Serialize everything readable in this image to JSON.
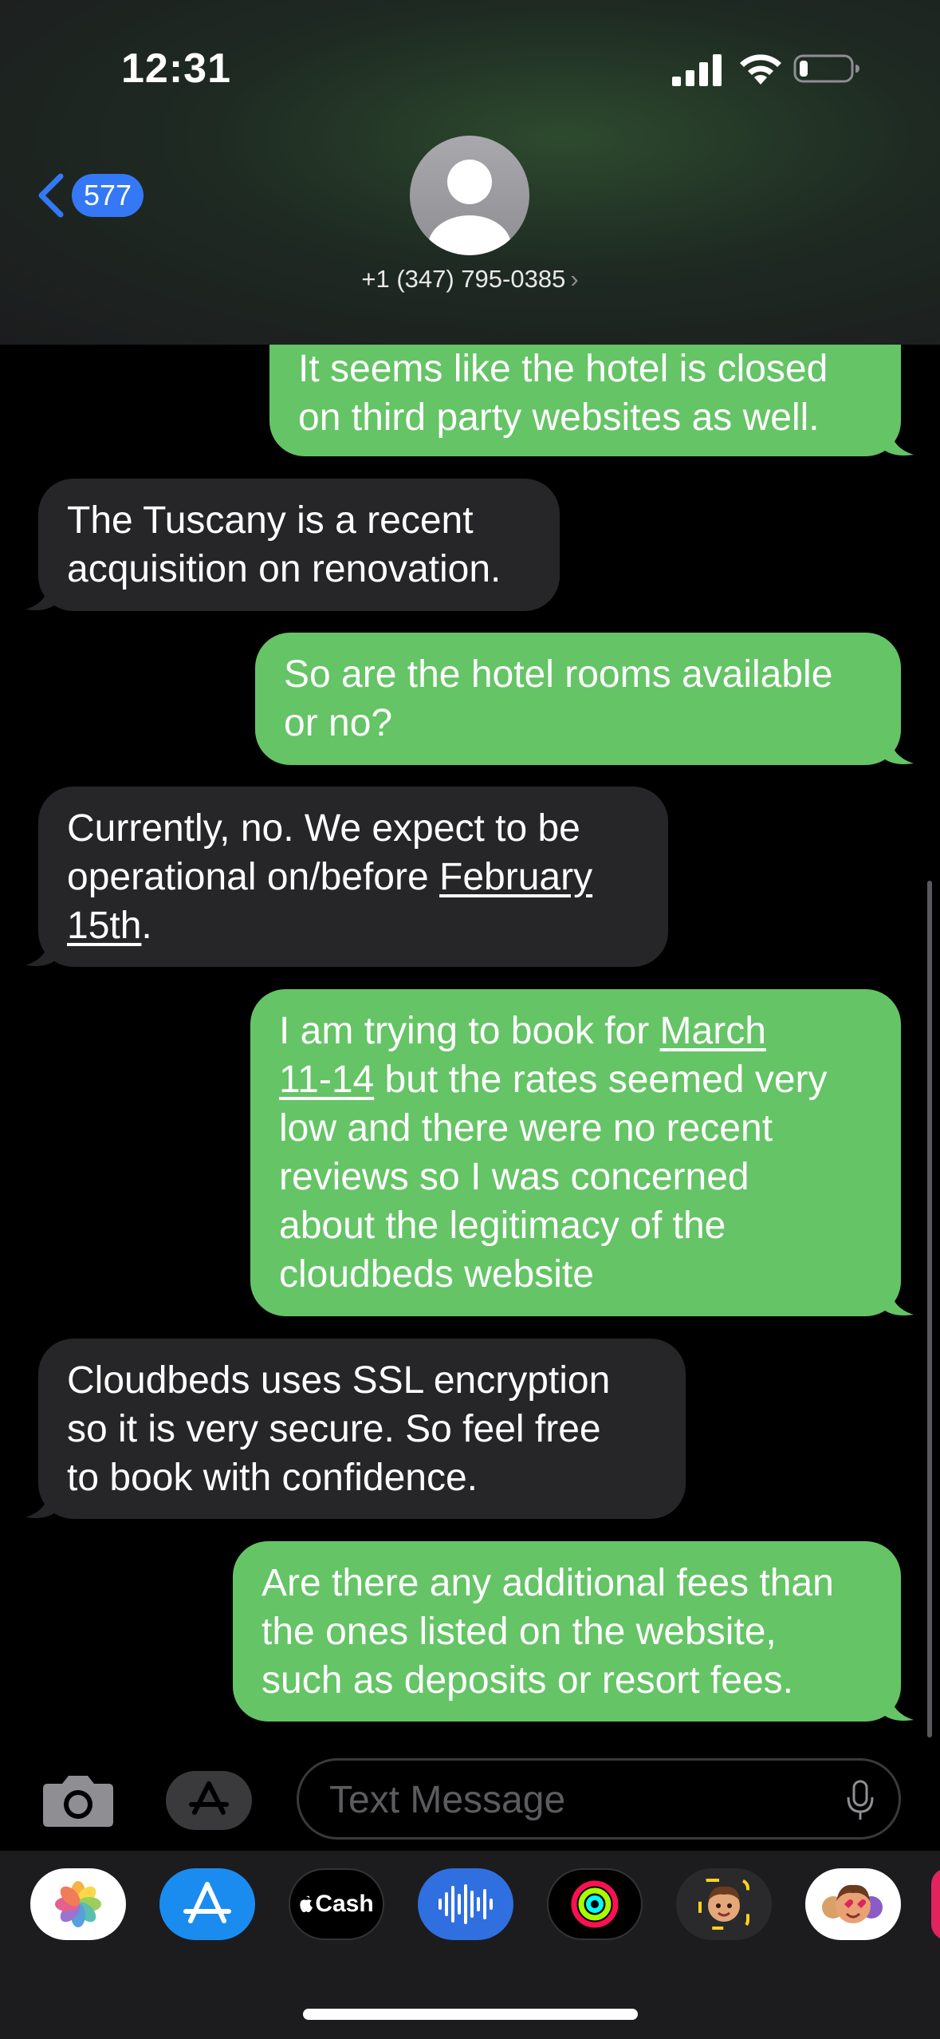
{
  "status_bar": {
    "time": "12:31"
  },
  "header": {
    "back_count": "577",
    "contact_name": "+1 (347) 795-0385",
    "contact_chevron": "›"
  },
  "messages": [
    {
      "direction": "outgoing",
      "lines": [
        "It seems like the hotel is closed",
        "on third party websites as well."
      ]
    },
    {
      "direction": "incoming",
      "lines": [
        "The Tuscany is a recent",
        "acquisition on renovation."
      ]
    },
    {
      "direction": "outgoing",
      "lines": [
        "So are the hotel rooms available",
        "or no?"
      ]
    },
    {
      "direction": "incoming",
      "line1": "Currently, no. We expect to be",
      "line2_prefix": "operational on/before ",
      "line2_link": "February",
      "line3_link": "15th",
      "line3_suffix": "."
    },
    {
      "direction": "outgoing",
      "line1_prefix": "I am trying to book for ",
      "line1_link": "March",
      "line2_link": "11-14",
      "line2_suffix": " but the rates seemed very",
      "rest": [
        "low and there were no recent",
        "reviews so I was concerned",
        "about the legitimacy of the",
        "cloudbeds website"
      ]
    },
    {
      "direction": "incoming",
      "lines": [
        "Cloudbeds uses SSL encryption",
        "so it is very secure. So feel free",
        "to book with confidence."
      ]
    },
    {
      "direction": "outgoing",
      "lines": [
        "Are there any additional fees than",
        "the ones listed on the website,",
        "such as deposits or resort fees."
      ]
    }
  ],
  "composer": {
    "placeholder": "Text Message"
  },
  "app_tray": [
    {
      "name": "Photos",
      "icon": "photos-icon"
    },
    {
      "name": "App Store",
      "icon": "app-store-icon"
    },
    {
      "name": "Apple Cash",
      "icon": "apple-cash-icon",
      "label": "Cash"
    },
    {
      "name": "Audio Message",
      "icon": "audio-waveform-icon"
    },
    {
      "name": "Activity",
      "icon": "activity-rings-icon"
    },
    {
      "name": "Memoji",
      "icon": "memoji-icon"
    },
    {
      "name": "Memoji Stickers",
      "icon": "memoji-stickers-icon"
    }
  ],
  "colors": {
    "outgoing_bubble": "#65c466",
    "incoming_bubble": "#262628",
    "accent_blue": "#3478f6",
    "background": "#000000"
  }
}
